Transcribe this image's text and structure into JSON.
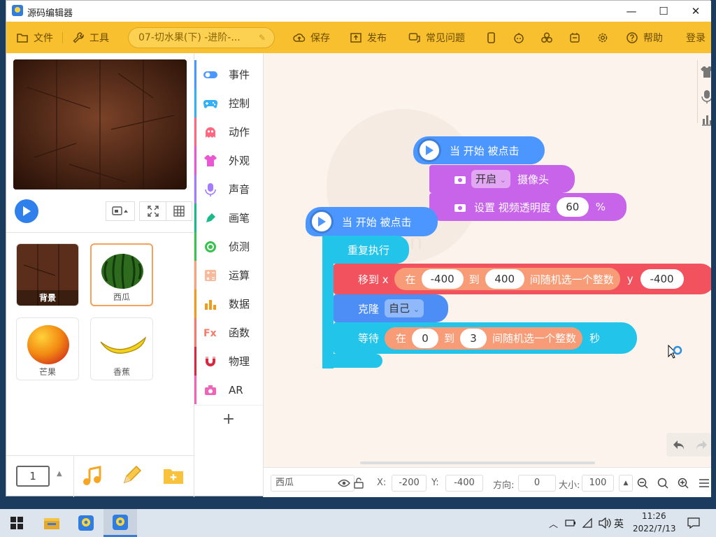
{
  "window": {
    "title": "源码编辑器",
    "minimize": "—",
    "maximize": "☐",
    "close": "✕"
  },
  "toolbar": {
    "file": "文件",
    "tools": "工具",
    "project_name": "07-切水果(下) -进阶-...",
    "save": "保存",
    "publish": "发布",
    "faq": "常见问题",
    "help": "帮助",
    "login": "登录"
  },
  "sprites": [
    {
      "name": "背景",
      "selected": false
    },
    {
      "name": "西瓜",
      "selected": true
    },
    {
      "name": "芒果",
      "selected": false
    },
    {
      "name": "香蕉",
      "selected": false
    }
  ],
  "scene_number": "1",
  "categories": [
    {
      "label": "事件",
      "color": "#4c97ff",
      "icon": "toggle-icon"
    },
    {
      "label": "控制",
      "color": "#36b0f5",
      "icon": "gamepad-icon"
    },
    {
      "label": "动作",
      "color": "#ff6680",
      "icon": "ghost-icon"
    },
    {
      "label": "外观",
      "color": "#e957d1",
      "icon": "shirt-icon"
    },
    {
      "label": "声音",
      "color": "#a57aff",
      "icon": "mic-icon"
    },
    {
      "label": "画笔",
      "color": "#19b98a",
      "icon": "pen-icon"
    },
    {
      "label": "侦测",
      "color": "#38c24f",
      "icon": "radar-icon"
    },
    {
      "label": "运算",
      "color": "#f5a37a",
      "icon": "calc-icon"
    },
    {
      "label": "数据",
      "color": "#f29b1b",
      "icon": "chart-icon"
    },
    {
      "label": "函数",
      "color": "#f47b6a",
      "icon": "function-icon"
    },
    {
      "label": "物理",
      "color": "#d8283f",
      "icon": "magnet-icon"
    },
    {
      "label": "AR",
      "color": "#f063b8",
      "icon": "camera-icon"
    }
  ],
  "blocks": {
    "hat1": "当 开始 被点击",
    "camera_on_opt": "开启",
    "camera_label": "摄像头",
    "video_trans_label": "设置 视频透明度",
    "video_trans_value": "60",
    "video_trans_unit": "%",
    "hat2": "当 开始 被点击",
    "repeat": "重复执行",
    "move_x": "移到 x",
    "rand_in": "在",
    "rand_to": "到",
    "rand_label": "间随机选一个整数",
    "rand1_from": "-400",
    "rand1_to": "400",
    "y_label": "y",
    "y_value": "-400",
    "clone": "克隆",
    "clone_opt": "自己",
    "wait": "等待",
    "rand2_from": "0",
    "rand2_to": "3",
    "wait_unit": "秒"
  },
  "status": {
    "sprite_name": "西瓜",
    "x_label": "X:",
    "x": "-200",
    "y_label": "Y:",
    "y": "-400",
    "dir_label": "方向:",
    "dir": "0",
    "size_label": "大小:",
    "size": "100"
  },
  "taskbar": {
    "ime": "英",
    "time": "11:26",
    "date": "2022/7/13"
  }
}
